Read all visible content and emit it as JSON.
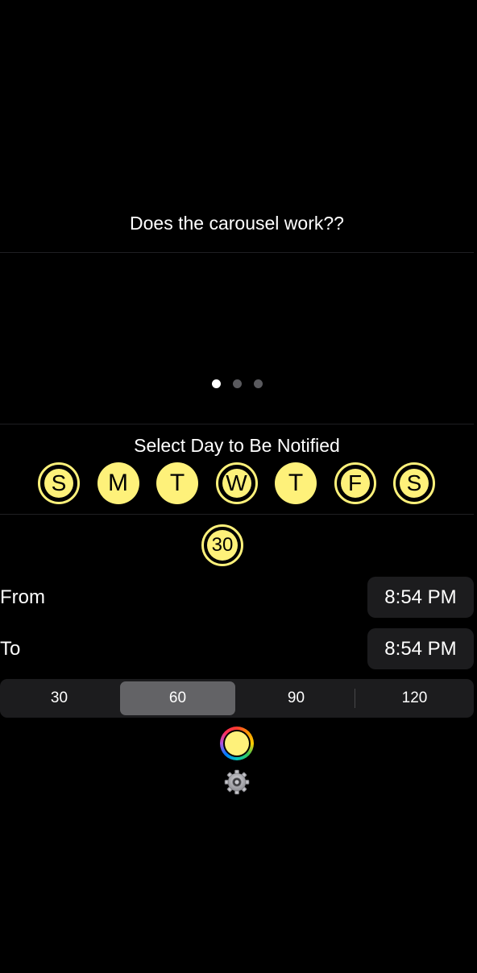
{
  "carousel": {
    "title": "Does the carousel work??",
    "page_count": 3,
    "current_page": 1
  },
  "days": {
    "title": "Select Day to Be Notified",
    "items": [
      {
        "label": "S",
        "selected": false
      },
      {
        "label": "M",
        "selected": true
      },
      {
        "label": "T",
        "selected": true
      },
      {
        "label": "W",
        "selected": false
      },
      {
        "label": "T",
        "selected": true
      },
      {
        "label": "F",
        "selected": false
      },
      {
        "label": "S",
        "selected": false
      }
    ]
  },
  "interval_badge": "30",
  "from": {
    "label": "From",
    "time": "8:54 PM"
  },
  "to": {
    "label": "To",
    "time": "8:54 PM"
  },
  "segments": {
    "options": [
      "30",
      "60",
      "90",
      "120"
    ],
    "selected": "60"
  },
  "color_picker": {
    "color": "#fef17a",
    "icon": "color-well-icon"
  },
  "settings": {
    "icon": "gear-icon"
  },
  "colors": {
    "accent": "#fef17a",
    "background": "#000000",
    "pill": "#1c1c1e",
    "segment_selected": "#636366"
  }
}
